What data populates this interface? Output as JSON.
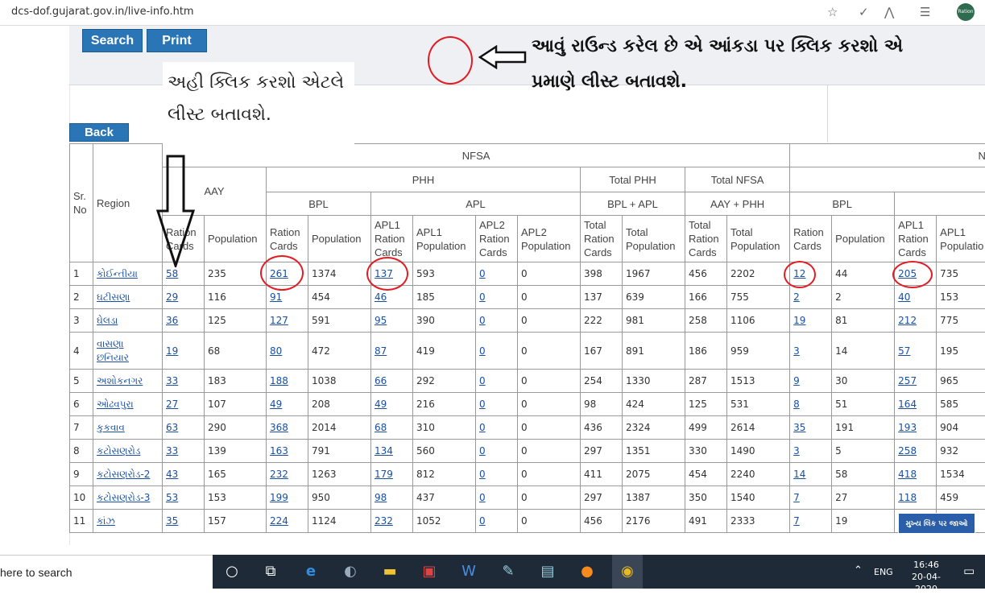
{
  "browser": {
    "url": "dcs-dof.gujarat.gov.in/live-info.htm",
    "profile_label": "Ration"
  },
  "toolbar": {
    "search_label": "Search",
    "print_label": "Print",
    "back_label": "Back"
  },
  "annotations": {
    "top_note_line1": "આવું રાઉન્ડ કરેલ છે એ આંકડા પર ક્લિક કરશો એ",
    "top_note_line2": "પ્રમાણે લીસ્ટ બતાવશે.",
    "left_note_line1": "અહી ક્લિક કરશો એટલે",
    "left_note_line2": "લીસ્ટ બતાવશે."
  },
  "table": {
    "headers": {
      "sr_no": "Sr. No",
      "region": "Region",
      "nfsa": "NFSA",
      "non_nfsa": "No",
      "aay": "AAY",
      "phh": "PHH",
      "total_phh": "Total PHH",
      "total_nfsa": "Total NFSA",
      "bpl": "BPL",
      "apl": "APL",
      "bpl_plus_apl": "BPL + APL",
      "aay_plus_phh": "AAY + PHH",
      "bpl2": "BPL",
      "ration_cards": "Ration Cards",
      "population": "Population",
      "apl1_ration_cards": "APL1 Ration Cards",
      "apl1_population": "APL1 Population",
      "apl2_ration_cards": "APL2 Ration Cards",
      "apl2_population": "APL2 Population",
      "total_ration_cards": "Total Ration Cards",
      "total_population": "Total Population",
      "apl1_populatio_cut": "APL1 Populatio"
    },
    "rows": [
      {
        "sr": "1",
        "region": "કોઈન્તીયા",
        "aay_rc": "58",
        "aay_pop": "235",
        "bpl_rc": "261",
        "bpl_pop": "1374",
        "apl1_rc": "137",
        "apl1_pop": "593",
        "apl2_rc": "0",
        "apl2_pop": "0",
        "tphh_rc": "398",
        "tphh_pop": "1967",
        "tnfsa_rc": "456",
        "tnfsa_pop": "2202",
        "nbpl_rc": "12",
        "nbpl_pop": "44",
        "napl1_rc": "205",
        "napl1_pop": "735"
      },
      {
        "sr": "2",
        "region": "ઘટીસણા",
        "aay_rc": "29",
        "aay_pop": "116",
        "bpl_rc": "91",
        "bpl_pop": "454",
        "apl1_rc": "46",
        "apl1_pop": "185",
        "apl2_rc": "0",
        "apl2_pop": "0",
        "tphh_rc": "137",
        "tphh_pop": "639",
        "tnfsa_rc": "166",
        "tnfsa_pop": "755",
        "nbpl_rc": "2",
        "nbpl_pop": "2",
        "napl1_rc": "40",
        "napl1_pop": "153"
      },
      {
        "sr": "3",
        "region": "ઘેલડા",
        "aay_rc": "36",
        "aay_pop": "125",
        "bpl_rc": "127",
        "bpl_pop": "591",
        "apl1_rc": "95",
        "apl1_pop": "390",
        "apl2_rc": "0",
        "apl2_pop": "0",
        "tphh_rc": "222",
        "tphh_pop": "981",
        "tnfsa_rc": "258",
        "tnfsa_pop": "1106",
        "nbpl_rc": "19",
        "nbpl_pop": "81",
        "napl1_rc": "212",
        "napl1_pop": "775"
      },
      {
        "sr": "4",
        "region": "વાસણા છનિયાર",
        "aay_rc": "19",
        "aay_pop": "68",
        "bpl_rc": "80",
        "bpl_pop": "472",
        "apl1_rc": "87",
        "apl1_pop": "419",
        "apl2_rc": "0",
        "apl2_pop": "0",
        "tphh_rc": "167",
        "tphh_pop": "891",
        "tnfsa_rc": "186",
        "tnfsa_pop": "959",
        "nbpl_rc": "3",
        "nbpl_pop": "14",
        "napl1_rc": "57",
        "napl1_pop": "195"
      },
      {
        "sr": "5",
        "region": "અશોકનગર",
        "aay_rc": "33",
        "aay_pop": "183",
        "bpl_rc": "188",
        "bpl_pop": "1038",
        "apl1_rc": "66",
        "apl1_pop": "292",
        "apl2_rc": "0",
        "apl2_pop": "0",
        "tphh_rc": "254",
        "tphh_pop": "1330",
        "tnfsa_rc": "287",
        "tnfsa_pop": "1513",
        "nbpl_rc": "9",
        "nbpl_pop": "30",
        "napl1_rc": "257",
        "napl1_pop": "965"
      },
      {
        "sr": "6",
        "region": "ઓઢવપુરા",
        "aay_rc": "27",
        "aay_pop": "107",
        "bpl_rc": "49",
        "bpl_pop": "208",
        "apl1_rc": "49",
        "apl1_pop": "216",
        "apl2_rc": "0",
        "apl2_pop": "0",
        "tphh_rc": "98",
        "tphh_pop": "424",
        "tnfsa_rc": "125",
        "tnfsa_pop": "531",
        "nbpl_rc": "8",
        "nbpl_pop": "51",
        "napl1_rc": "164",
        "napl1_pop": "585"
      },
      {
        "sr": "7",
        "region": "કુકવાવ",
        "aay_rc": "63",
        "aay_pop": "290",
        "bpl_rc": "368",
        "bpl_pop": "2014",
        "apl1_rc": "68",
        "apl1_pop": "310",
        "apl2_rc": "0",
        "apl2_pop": "0",
        "tphh_rc": "436",
        "tphh_pop": "2324",
        "tnfsa_rc": "499",
        "tnfsa_pop": "2614",
        "nbpl_rc": "35",
        "nbpl_pop": "191",
        "napl1_rc": "193",
        "napl1_pop": "904"
      },
      {
        "sr": "8",
        "region": "કટોસણરોડ",
        "aay_rc": "33",
        "aay_pop": "139",
        "bpl_rc": "163",
        "bpl_pop": "791",
        "apl1_rc": "134",
        "apl1_pop": "560",
        "apl2_rc": "0",
        "apl2_pop": "0",
        "tphh_rc": "297",
        "tphh_pop": "1351",
        "tnfsa_rc": "330",
        "tnfsa_pop": "1490",
        "nbpl_rc": "3",
        "nbpl_pop": "5",
        "napl1_rc": "258",
        "napl1_pop": "932"
      },
      {
        "sr": "9",
        "region": "કટોસણરોડ-2",
        "aay_rc": "43",
        "aay_pop": "165",
        "bpl_rc": "232",
        "bpl_pop": "1263",
        "apl1_rc": "179",
        "apl1_pop": "812",
        "apl2_rc": "0",
        "apl2_pop": "0",
        "tphh_rc": "411",
        "tphh_pop": "2075",
        "tnfsa_rc": "454",
        "tnfsa_pop": "2240",
        "nbpl_rc": "14",
        "nbpl_pop": "58",
        "napl1_rc": "418",
        "napl1_pop": "1534"
      },
      {
        "sr": "10",
        "region": "કટોસણરોડ-3",
        "aay_rc": "53",
        "aay_pop": "153",
        "bpl_rc": "199",
        "bpl_pop": "950",
        "apl1_rc": "98",
        "apl1_pop": "437",
        "apl2_rc": "0",
        "apl2_pop": "0",
        "tphh_rc": "297",
        "tphh_pop": "1387",
        "tnfsa_rc": "350",
        "tnfsa_pop": "1540",
        "nbpl_rc": "7",
        "nbpl_pop": "27",
        "napl1_rc": "118",
        "napl1_pop": "459"
      },
      {
        "sr": "11",
        "region": "કાંઝ",
        "aay_rc": "35",
        "aay_pop": "157",
        "bpl_rc": "224",
        "bpl_pop": "1124",
        "apl1_rc": "232",
        "apl1_pop": "1052",
        "apl2_rc": "0",
        "apl2_pop": "0",
        "tphh_rc": "456",
        "tphh_pop": "2176",
        "tnfsa_rc": "491",
        "tnfsa_pop": "2333",
        "nbpl_rc": "7",
        "nbpl_pop": "19",
        "napl1_rc": "",
        "napl1_pop": ""
      }
    ]
  },
  "main_link_label": "મુખ્ય લિંક પર જાઓ",
  "taskbar": {
    "search_placeholder": "here to search",
    "language": "ENG",
    "time": "16:46",
    "date": "20-04-2020"
  },
  "colors": {
    "accent": "#2a75b6",
    "annotation_red": "#e21c24",
    "link": "#1a4fa3",
    "taskbar": "#1e2a38"
  }
}
